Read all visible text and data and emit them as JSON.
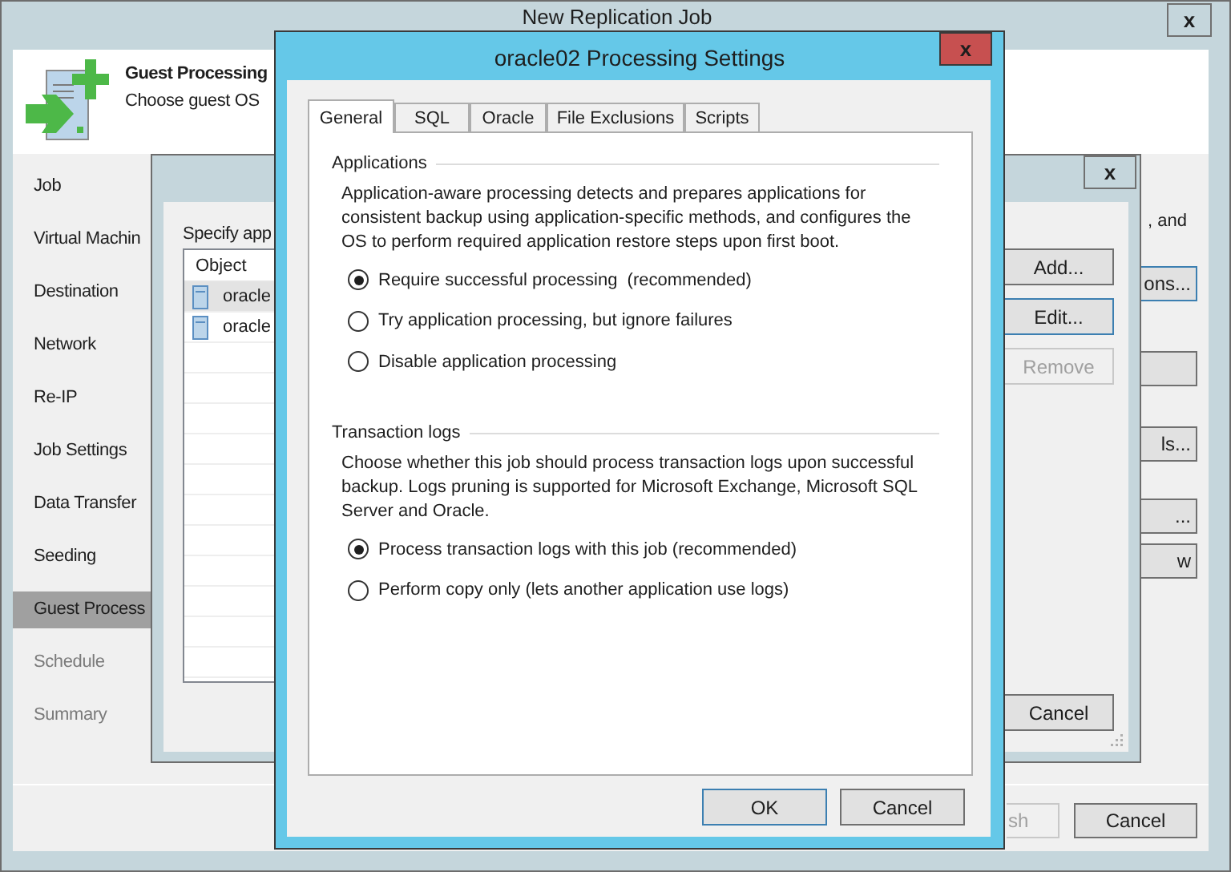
{
  "main_window": {
    "title": "New Replication Job",
    "close_label": "x",
    "header": {
      "title": "Guest Processing",
      "subtitle": "Choose guest OS"
    },
    "steps": [
      {
        "label": "Job",
        "selected": false,
        "disabled": false
      },
      {
        "label": "Virtual Machin",
        "selected": false,
        "disabled": false
      },
      {
        "label": "Destination",
        "selected": false,
        "disabled": false
      },
      {
        "label": "Network",
        "selected": false,
        "disabled": false
      },
      {
        "label": "Re-IP",
        "selected": false,
        "disabled": false
      },
      {
        "label": "Job Settings",
        "selected": false,
        "disabled": false
      },
      {
        "label": "Data Transfer",
        "selected": false,
        "disabled": false
      },
      {
        "label": "Seeding",
        "selected": false,
        "disabled": false
      },
      {
        "label": "Guest Process",
        "selected": true,
        "disabled": false
      },
      {
        "label": "Schedule",
        "selected": false,
        "disabled": true
      },
      {
        "label": "Summary",
        "selected": false,
        "disabled": true
      }
    ],
    "side_text": ", and",
    "side_buttons": [
      "ons...",
      "ls...",
      "...",
      "w"
    ],
    "footer_buttons": [
      {
        "label": "sh",
        "disabled": true
      },
      {
        "label": "Cancel",
        "disabled": false
      }
    ]
  },
  "app_dialog": {
    "close_label": "x",
    "instruction": "Specify app",
    "columns": [
      "Object"
    ],
    "rows": [
      {
        "name": "oracle",
        "selected": true
      },
      {
        "name": "oracle",
        "selected": false
      }
    ],
    "buttons": [
      {
        "label": "Add...",
        "disabled": false,
        "focused": false
      },
      {
        "label": "Edit...",
        "disabled": false,
        "focused": true
      },
      {
        "label": "Remove",
        "disabled": true,
        "focused": false
      }
    ],
    "cancel": "Cancel"
  },
  "settings_dialog": {
    "title": "oracle02 Processing Settings",
    "close_label": "x",
    "tabs": [
      {
        "label": "General",
        "selected": true
      },
      {
        "label": "SQL",
        "selected": false
      },
      {
        "label": "Oracle",
        "selected": false
      },
      {
        "label": "File Exclusions",
        "selected": false
      },
      {
        "label": "Scripts",
        "selected": false
      }
    ],
    "groups": [
      {
        "title": "Applications",
        "description": "Application-aware processing detects and prepares applications for consistent backup using application-specific methods, and configures the OS to perform required application restore steps upon first boot.",
        "options": [
          {
            "label": "Require successful processing  (recommended)",
            "selected": true
          },
          {
            "label": "Try application processing, but ignore failures",
            "selected": false
          },
          {
            "label": "Disable application processing",
            "selected": false
          }
        ]
      },
      {
        "title": "Transaction logs",
        "description": "Choose whether this job should process transaction logs upon successful backup. Logs pruning is supported for Microsoft Exchange, Microsoft SQL Server and Oracle.",
        "options": [
          {
            "label": "Process transaction logs with this job (recommended)",
            "selected": true
          },
          {
            "label": "Perform copy only (lets another application use logs)",
            "selected": false
          }
        ]
      }
    ],
    "buttons": [
      {
        "label": "OK",
        "default": true
      },
      {
        "label": "Cancel",
        "default": false
      }
    ]
  }
}
